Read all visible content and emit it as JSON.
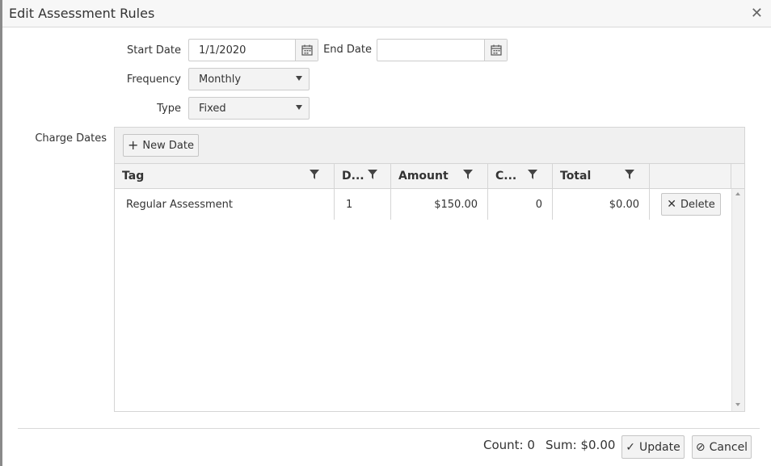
{
  "dialog": {
    "title": "Edit Assessment Rules",
    "close_icon": "close-icon"
  },
  "form": {
    "start_date_label": "Start Date",
    "start_date_value": "1/1/2020",
    "end_date_label": "End Date",
    "end_date_value": "",
    "frequency_label": "Frequency",
    "frequency_value": "Monthly",
    "type_label": "Type",
    "type_value": "Fixed",
    "charge_dates_label": "Charge Dates"
  },
  "grid": {
    "new_date_label": "New Date",
    "columns": [
      {
        "label": "Tag"
      },
      {
        "label": "D..."
      },
      {
        "label": "Amount"
      },
      {
        "label": "C..."
      },
      {
        "label": "Total"
      }
    ],
    "rows": [
      {
        "tag": "Regular Assessment",
        "d": "1",
        "amount": "$150.00",
        "c": "0",
        "total": "$0.00",
        "delete_label": "Delete"
      }
    ]
  },
  "footer": {
    "count": "Count: 0",
    "sum": "Sum: $0.00",
    "update_label": "Update",
    "cancel_label": "Cancel"
  },
  "colors": {
    "border": "#d5d5d5",
    "header_bg": "#f3f3f3",
    "toolbar_bg": "#f0f0f0",
    "text": "#333333"
  }
}
